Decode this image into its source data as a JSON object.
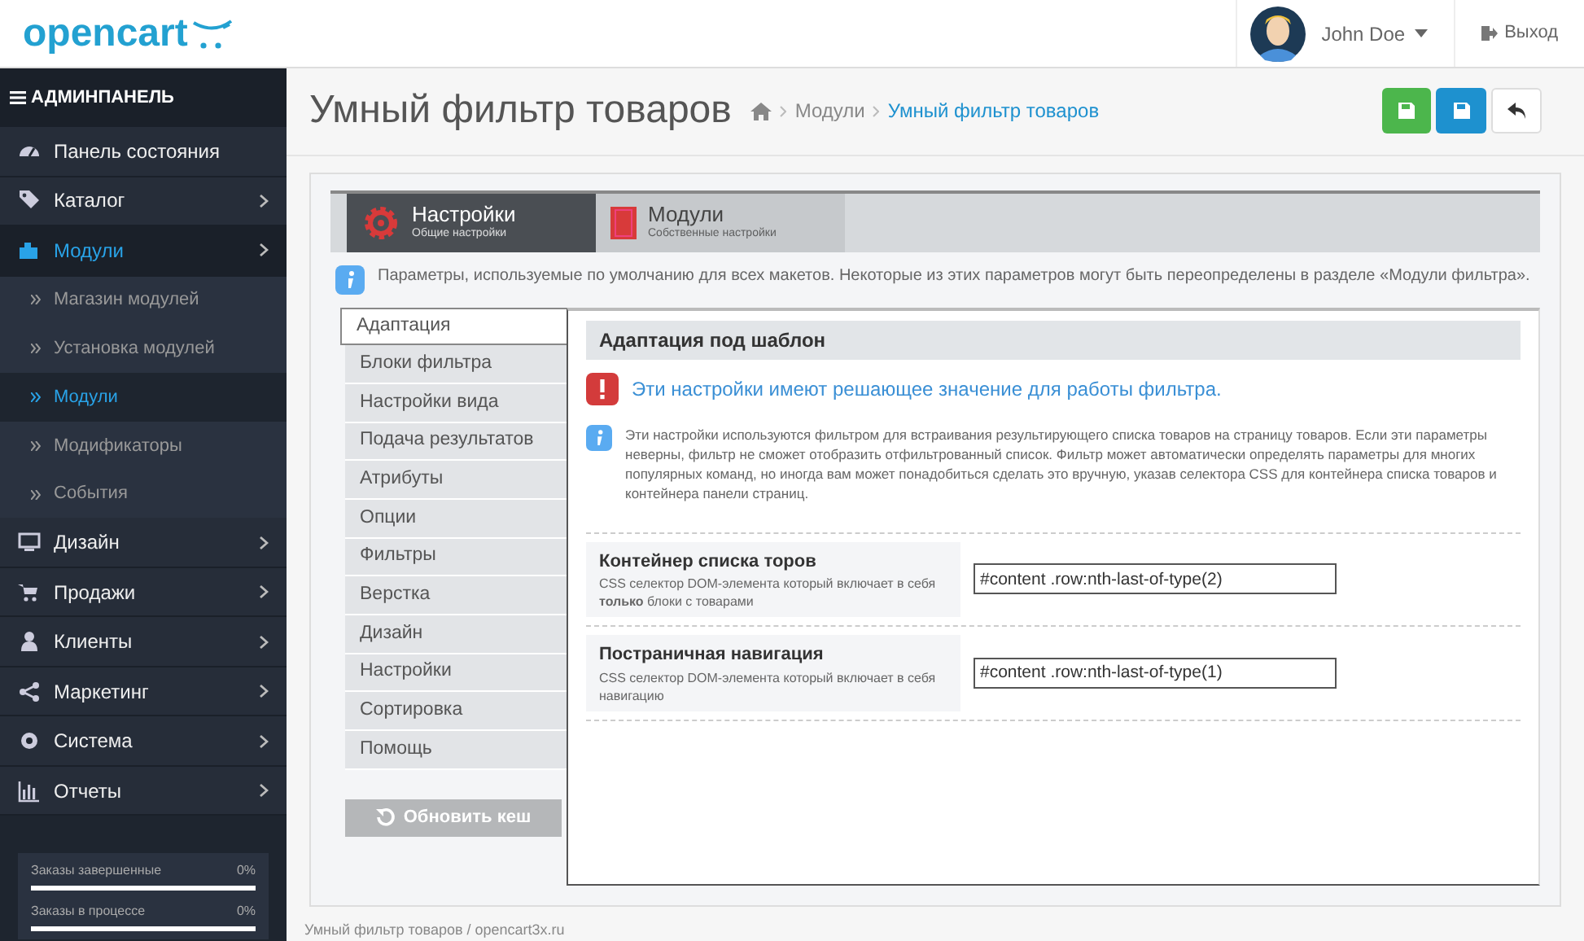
{
  "header": {
    "logo": "opencart",
    "user": "John Doe",
    "logout": "Выход"
  },
  "sidebar": {
    "title": "АДМИНПАНЕЛЬ",
    "items": [
      {
        "label": "Панель состояния",
        "selected": false
      },
      {
        "label": "Каталог",
        "selected": false
      },
      {
        "label": "Модули",
        "selected": true,
        "expanded": true,
        "children": [
          {
            "label": "Магазин модулей",
            "selected": false
          },
          {
            "label": "Установка модулей",
            "selected": false
          },
          {
            "label": "Модули",
            "selected": true
          },
          {
            "label": "Модификаторы",
            "selected": false
          },
          {
            "label": "События",
            "selected": false
          }
        ]
      },
      {
        "label": "Дизайн",
        "selected": false
      },
      {
        "label": "Продажи",
        "selected": false
      },
      {
        "label": "Клиенты",
        "selected": false
      },
      {
        "label": "Маркетинг",
        "selected": false
      },
      {
        "label": "Система",
        "selected": false
      },
      {
        "label": "Отчеты",
        "selected": false
      }
    ],
    "stats": [
      {
        "label": "Заказы завершенные",
        "value": "0%",
        "level": 0
      },
      {
        "label": "Заказы в процессе",
        "value": "0%",
        "level": 0
      }
    ]
  },
  "page": {
    "title": "Умный фильтр товаров",
    "breadcrumbs": [
      "Модули",
      "Умный фильтр товаров"
    ]
  },
  "tabs": [
    {
      "title": "Настройки",
      "subtitle": "Общие настройки",
      "selected": true
    },
    {
      "title": "Модули",
      "subtitle": "Собственные настройки",
      "selected": false
    }
  ],
  "info": "Параметры, используемые по умолчанию для всех макетов. Некоторые из этих параметров могут быть переопределены в разделе «Модули фильтра».",
  "vertical_tabs": [
    {
      "label": "Адаптация",
      "selected": true
    },
    {
      "label": "Блоки фильтра",
      "selected": false
    },
    {
      "label": "Настройки вида",
      "selected": false
    },
    {
      "label": "Подача результатов",
      "selected": false
    },
    {
      "label": "Атрибуты",
      "selected": false
    },
    {
      "label": "Опции",
      "selected": false
    },
    {
      "label": "Фильтры",
      "selected": false
    },
    {
      "label": "Верстка",
      "selected": false
    },
    {
      "label": "Дизайн",
      "selected": false
    },
    {
      "label": "Настройки",
      "selected": false
    },
    {
      "label": "Сортировка",
      "selected": false
    },
    {
      "label": "Помощь",
      "selected": false
    }
  ],
  "refresh_button": "Обновить кеш",
  "section": {
    "heading": "Адаптация под шаблон",
    "warning": "Эти настройки имеют решающее значение для работы фильтра.",
    "note": "Эти настройки используются фильтром для встраивания результирующего списка товаров на страницу товаров. Если эти параметры неверны, фильтр не сможет отобразить отфильтрованный список. Фильтр может автоматически определять параметры для многих популярных команд, но иногда вам может понадобиться сделать это вручную, указав селектора CSS для контейнера списка товаров и контейнера панели страниц.",
    "fields": [
      {
        "label": "Контейнер списка торов",
        "help": "CSS селектор DOM-элемента который включает в себя **только** блоки с товарами",
        "value": "#content .row:nth-last-of-type(2)"
      },
      {
        "label": "Постраничная навигация",
        "help": "CSS селектор DOM-элемента который включает в себя навигацию",
        "value": "#content .row:nth-last-of-type(1)"
      }
    ]
  },
  "footer": "Умный фильтр товаров / opencart3x.ru"
}
